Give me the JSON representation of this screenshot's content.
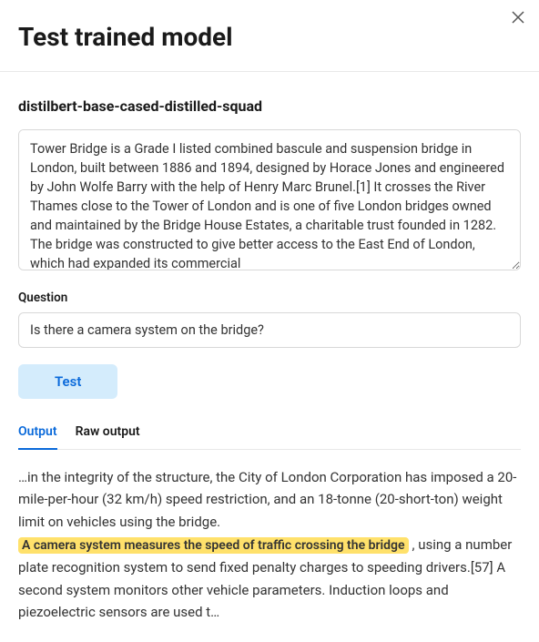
{
  "header": {
    "title": "Test trained model",
    "close_icon": "close-icon"
  },
  "model": {
    "name": "distilbert-base-cased-distilled-squad"
  },
  "context": {
    "value": "Tower Bridge is a Grade I listed combined bascule and suspension bridge in London, built between 1886 and 1894, designed by Horace Jones and engineered by John Wolfe Barry with the help of Henry Marc Brunel.[1] It crosses the River Thames close to the Tower of London and is one of five London bridges owned and maintained by the Bridge House Estates, a charitable trust founded in 1282. The bridge was constructed to give better access to the East End of London, which had expanded its commercial "
  },
  "question": {
    "label": "Question",
    "value": "Is there a camera system on the bridge?"
  },
  "actions": {
    "test_label": "Test"
  },
  "tabs": {
    "output": "Output",
    "raw_output": "Raw output"
  },
  "output": {
    "pre_text": "…in the integrity of the structure, the City of London Corporation has imposed a 20-mile-per-hour (32 km/h) speed restriction, and an 18-tonne (20-short-ton) weight limit on vehicles using the bridge.",
    "highlight": "A camera system measures the speed of traffic crossing the bridge",
    "post_text": ", using a number plate recognition system to send fixed penalty charges to speeding drivers.[57] A second system monitors other vehicle parameters. Induction loops and piezoelectric sensors are used t…"
  }
}
